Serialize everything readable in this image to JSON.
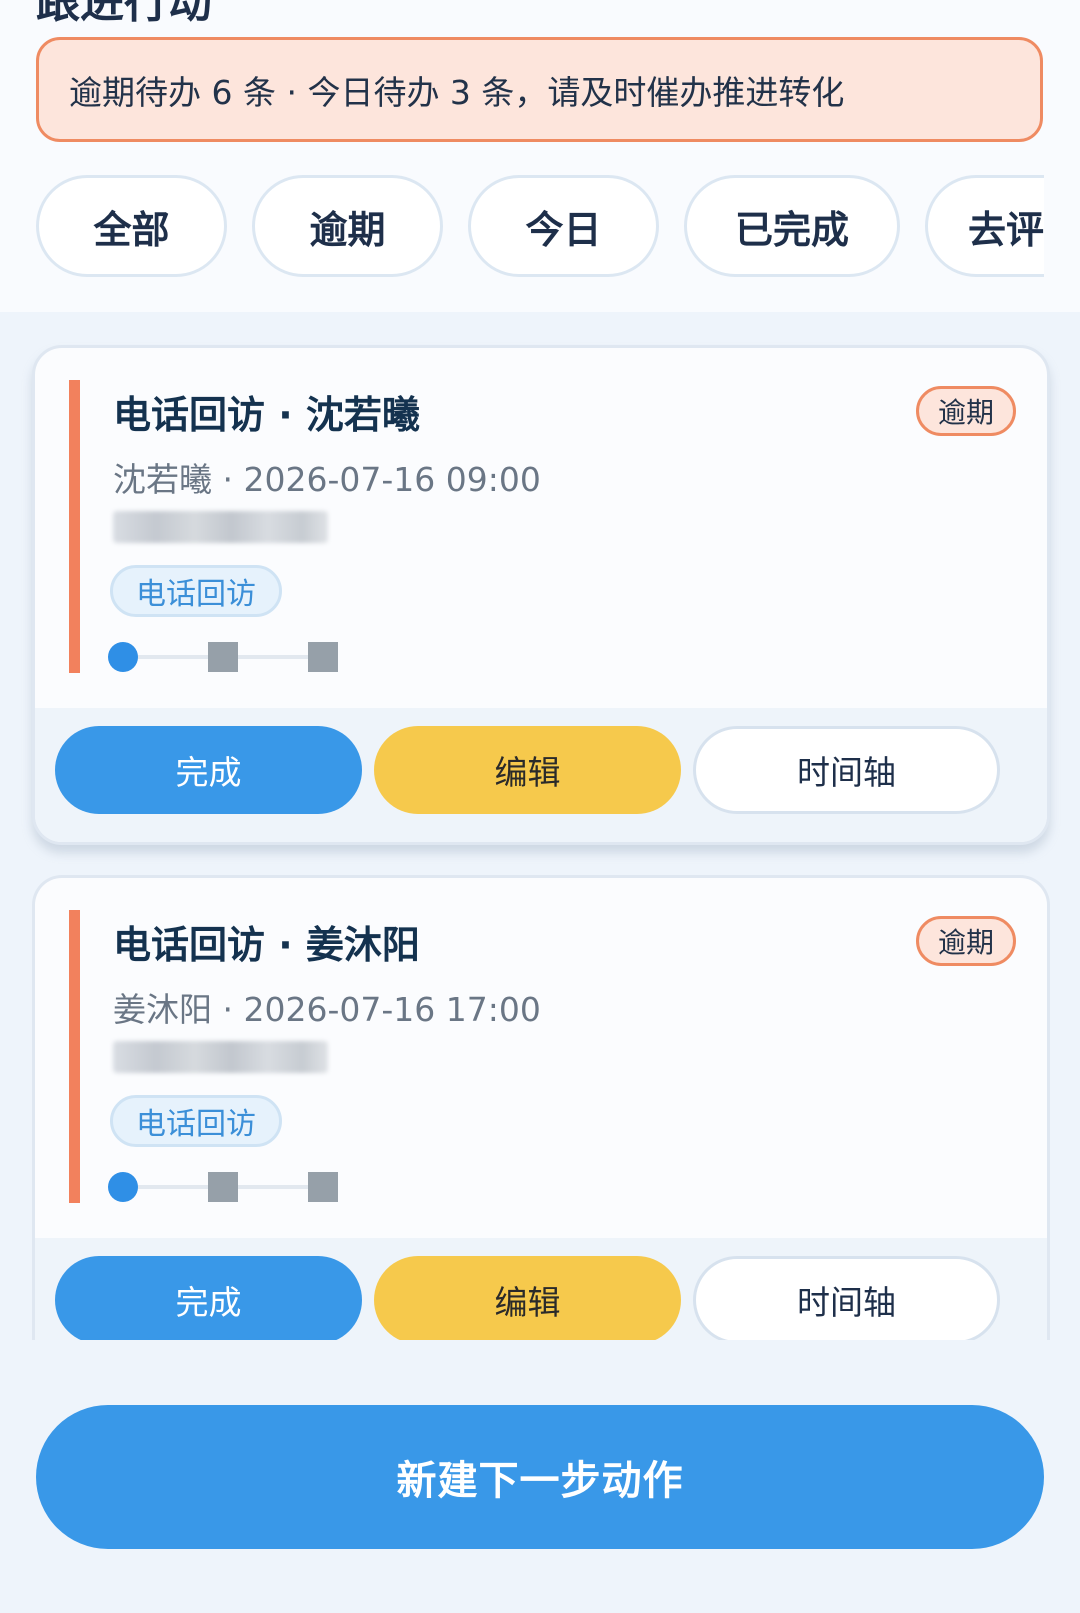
{
  "page_title": "跟进行动",
  "alert": {
    "text": "逾期待办 6 条 · 今日待办 3 条，请及时催办推进转化"
  },
  "filters": [
    {
      "label": "全部"
    },
    {
      "label": "逾期"
    },
    {
      "label": "今日"
    },
    {
      "label": "已完成"
    },
    {
      "label": "去评"
    }
  ],
  "tasks": [
    {
      "title": "电话回访 · 沈若曦",
      "badge": "逾期",
      "meta": "沈若曦 · 2026-07-16 09:00",
      "type_tag": "电话回访",
      "progress_step": 1,
      "progress_total": 3,
      "actions": {
        "done": "完成",
        "edit": "编辑",
        "timeline": "时间轴"
      }
    },
    {
      "title": "电话回访 · 姜沐阳",
      "badge": "逾期",
      "meta": "姜沐阳 · 2026-07-16 17:00",
      "type_tag": "电话回访",
      "progress_step": 1,
      "progress_total": 3,
      "actions": {
        "done": "完成",
        "edit": "编辑",
        "timeline": "时间轴"
      }
    }
  ],
  "bottom": {
    "new_action_label": "新建下一步动作"
  },
  "colors": {
    "accent_blue": "#3998e8",
    "overdue_orange": "#ef8b62",
    "edit_yellow": "#f6c94c",
    "title_navy": "#14324f"
  }
}
